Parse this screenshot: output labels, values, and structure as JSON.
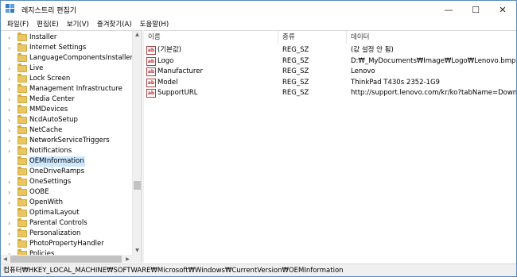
{
  "window": {
    "title": "레지스트리 편집기",
    "controls": {
      "minimize": "—",
      "maximize": "☐",
      "close": "✕"
    }
  },
  "menu": [
    "파일(F)",
    "편집(E)",
    "보기(V)",
    "즐겨찾기(A)",
    "도움말(H)"
  ],
  "tree": {
    "items": [
      {
        "label": "Installer",
        "expandable": true,
        "selected": false
      },
      {
        "label": "Internet Settings",
        "expandable": true,
        "selected": false
      },
      {
        "label": "LanguageComponentsInstaller",
        "expandable": false,
        "selected": false
      },
      {
        "label": "Live",
        "expandable": true,
        "selected": false
      },
      {
        "label": "Lock Screen",
        "expandable": true,
        "selected": false
      },
      {
        "label": "Management Infrastructure",
        "expandable": true,
        "selected": false
      },
      {
        "label": "Media Center",
        "expandable": true,
        "selected": false
      },
      {
        "label": "MMDevices",
        "expandable": true,
        "selected": false
      },
      {
        "label": "NcdAutoSetup",
        "expandable": true,
        "selected": false
      },
      {
        "label": "NetCache",
        "expandable": true,
        "selected": false
      },
      {
        "label": "NetworkServiceTriggers",
        "expandable": true,
        "selected": false
      },
      {
        "label": "Notifications",
        "expandable": true,
        "selected": false
      },
      {
        "label": "OEMInformation",
        "expandable": false,
        "selected": true
      },
      {
        "label": "OneDriveRamps",
        "expandable": false,
        "selected": false
      },
      {
        "label": "OneSettings",
        "expandable": true,
        "selected": false
      },
      {
        "label": "OOBE",
        "expandable": true,
        "selected": false
      },
      {
        "label": "OpenWith",
        "expandable": true,
        "selected": false
      },
      {
        "label": "OptimalLayout",
        "expandable": false,
        "selected": false
      },
      {
        "label": "Parental Controls",
        "expandable": true,
        "selected": false
      },
      {
        "label": "Personalization",
        "expandable": true,
        "selected": false
      },
      {
        "label": "PhotoPropertyHandler",
        "expandable": true,
        "selected": false
      },
      {
        "label": "Policies",
        "expandable": true,
        "selected": false
      }
    ]
  },
  "values": {
    "headers": {
      "name": "이름",
      "type": "종류",
      "data": "데이터"
    },
    "icon_text": "ab",
    "rows": [
      {
        "name": "(기본값)",
        "type": "REG_SZ",
        "data": "(값 설정 안 됨)"
      },
      {
        "name": "Logo",
        "type": "REG_SZ",
        "data": "D:₩_MyDocuments₩Image₩Logo₩Lenovo.bmp"
      },
      {
        "name": "Manufacturer",
        "type": "REG_SZ",
        "data": "Lenovo"
      },
      {
        "name": "Model",
        "type": "REG_SZ",
        "data": "ThinkPad T430s 2352-1G9"
      },
      {
        "name": "SupportURL",
        "type": "REG_SZ",
        "data": "http://support.lenovo.com/kr/ko?tabName=Download"
      }
    ]
  },
  "status": {
    "path": "컴퓨터₩HKEY_LOCAL_MACHINE₩SOFTWARE₩Microsoft₩Windows₩CurrentVersion₩OEMInformation"
  },
  "colors": {
    "selection": "#cce8ff",
    "folder": "#e9c664",
    "border": "#5a8ac0"
  },
  "icons": {
    "app": "registry-editor-icon",
    "folder": "folder-icon",
    "string_value": "string-value-icon"
  }
}
